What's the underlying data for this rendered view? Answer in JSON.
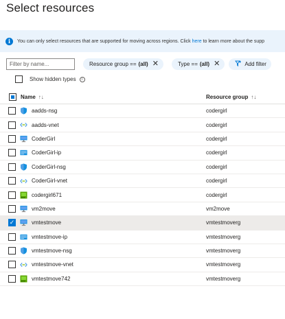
{
  "page": {
    "title": "Select resources"
  },
  "info": {
    "text_before": "You can only select resources that are supported for moving across regions. Click ",
    "link": "here",
    "text_after": " to learn more about the supp"
  },
  "filters": {
    "placeholder": "Filter by name...",
    "pill_rg_label": "Resource group ==",
    "pill_rg_value": "(all)",
    "pill_type_label": "Type ==",
    "pill_type_value": "(all)",
    "add_filter": "Add filter"
  },
  "options": {
    "show_hidden_types": "Show hidden types"
  },
  "table": {
    "col_name": "Name",
    "col_name_sort": "↑↓",
    "col_rg": "Resource group",
    "col_rg_sort": "↑↓",
    "rows": [
      {
        "name": "aadds-nsg",
        "rg": "codergirl",
        "icon": "nsg-icon",
        "selected": false
      },
      {
        "name": "aadds-vnet",
        "rg": "codergirl",
        "icon": "vnet-icon",
        "selected": false
      },
      {
        "name": "CoderGirl",
        "rg": "codergirl",
        "icon": "vm-icon",
        "selected": false
      },
      {
        "name": "CoderGirl-ip",
        "rg": "codergirl",
        "icon": "public-ip-icon",
        "selected": false
      },
      {
        "name": "CoderGirl-nsg",
        "rg": "codergirl",
        "icon": "nsg-icon",
        "selected": false
      },
      {
        "name": "CoderGirl-vnet",
        "rg": "codergirl",
        "icon": "vnet-icon",
        "selected": false
      },
      {
        "name": "codergirl671",
        "rg": "codergirl",
        "icon": "nic-icon",
        "selected": false
      },
      {
        "name": "vm2move",
        "rg": "vm2move",
        "icon": "vm-icon",
        "selected": false
      },
      {
        "name": "vmtestmove",
        "rg": "vmtestmoverg",
        "icon": "vm-icon",
        "selected": true
      },
      {
        "name": "vmtestmove-ip",
        "rg": "vmtestmoverg",
        "icon": "public-ip-icon",
        "selected": false
      },
      {
        "name": "vmtestmove-nsg",
        "rg": "vmtestmoverg",
        "icon": "nsg-icon",
        "selected": false
      },
      {
        "name": "vmtestmove-vnet",
        "rg": "vmtestmoverg",
        "icon": "vnet-icon",
        "selected": false
      },
      {
        "name": "vmtestmove742",
        "rg": "vmtestmoverg",
        "icon": "nic-icon",
        "selected": false
      }
    ]
  }
}
